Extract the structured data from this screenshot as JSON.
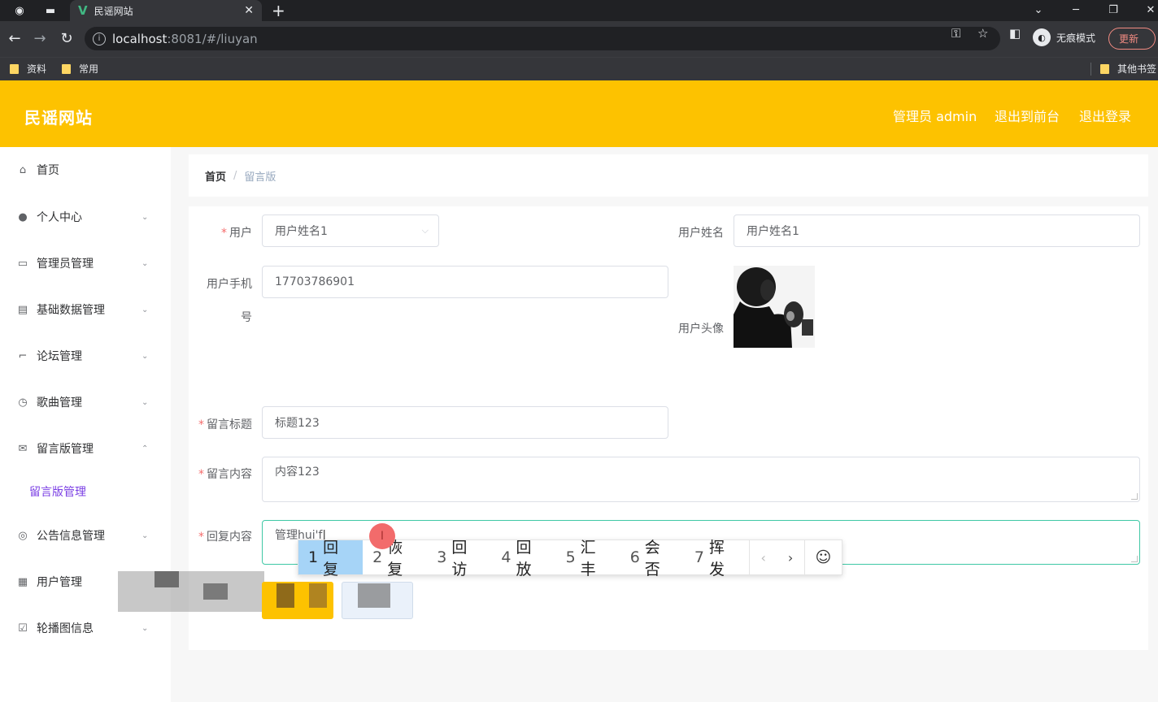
{
  "browser": {
    "tab_title": "民谣网站",
    "url_host": "localhost",
    "url_rest": ":8081/#/liuyan",
    "profile_label": "无痕模式",
    "update_label": "更新",
    "bookmarks": [
      "资料",
      "常用",
      "其他书签"
    ]
  },
  "header": {
    "logo": "民谣网站",
    "admin": "管理员 admin",
    "back_front": "退出到前台",
    "logout": "退出登录"
  },
  "sidebar": {
    "items": [
      {
        "label": "首页",
        "icon": "home-icon"
      },
      {
        "label": "个人中心",
        "icon": "user-icon"
      },
      {
        "label": "管理员管理",
        "icon": "chat-icon"
      },
      {
        "label": "基础数据管理",
        "icon": "card-icon"
      },
      {
        "label": "论坛管理",
        "icon": "crop-icon"
      },
      {
        "label": "歌曲管理",
        "icon": "clock-icon"
      },
      {
        "label": "留言版管理",
        "icon": "mail-icon"
      },
      {
        "label": "公告信息管理",
        "icon": "badge-icon"
      },
      {
        "label": "用户管理",
        "icon": "doc-icon"
      },
      {
        "label": "轮播图信息",
        "icon": "check-icon"
      }
    ],
    "submenu_active": "留言版管理"
  },
  "breadcrumb": {
    "home": "首页",
    "sep": "/",
    "current": "留言版"
  },
  "form": {
    "user_label": "用户",
    "user_value": "用户姓名1",
    "username_label": "用户姓名",
    "username_value": "用户姓名1",
    "phone_label_1": "用户手机",
    "phone_label_2": "号",
    "phone_value": "17703786901",
    "avatar_label": "用户头像",
    "title_label": "留言标题",
    "title_value": "标题123",
    "content_label": "留言内容",
    "content_value": "内容123",
    "reply_label": "回复内容",
    "reply_value": "管理hui'f"
  },
  "ime": {
    "candidates": [
      {
        "num": "1",
        "text": "回复"
      },
      {
        "num": "2",
        "text": "恢复"
      },
      {
        "num": "3",
        "text": "回访"
      },
      {
        "num": "4",
        "text": "回放"
      },
      {
        "num": "5",
        "text": "汇丰"
      },
      {
        "num": "6",
        "text": "会否"
      },
      {
        "num": "7",
        "text": "挥发"
      }
    ]
  },
  "colors": {
    "header_bg": "#fdc200",
    "submenu_active": "#7b3fe4",
    "focus_border": "#3fc8a5",
    "required": "#f56c6c"
  }
}
